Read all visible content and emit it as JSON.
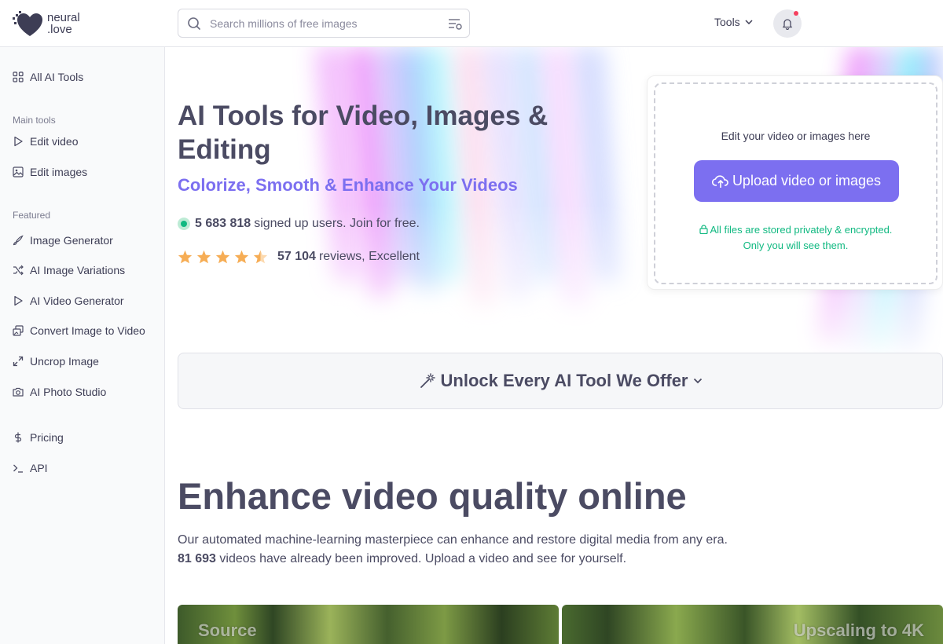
{
  "header": {
    "logo_line1": "neural",
    "logo_line2": ".love",
    "search_placeholder": "Search millions of free images",
    "tools_label": "Tools"
  },
  "sidebar": {
    "all_tools": "All AI Tools",
    "main_heading": "Main tools",
    "main_items": [
      "Edit video",
      "Edit images"
    ],
    "featured_heading": "Featured",
    "featured_items": [
      "Image Generator",
      "AI Image Variations",
      "AI Video Generator",
      "Convert Image to Video",
      "Uncrop Image",
      "AI Photo Studio"
    ],
    "bottom_items": [
      "Pricing",
      "API"
    ]
  },
  "hero": {
    "title": "AI Tools for Video, Images & Editing",
    "subtitle": "Colorize, Smooth & Enhance Your Videos",
    "users_count": "5 683 818",
    "users_text": "signed up users. Join for free.",
    "rating_stars": 4.5,
    "reviews_count": "57 104",
    "reviews_text": "reviews, Excellent"
  },
  "upload": {
    "hint": "Edit your video or images here",
    "button": "Upload video or images",
    "secure_line1": "All files are stored privately & encrypted.",
    "secure_line2": "Only you will see them."
  },
  "unlock": {
    "label": "Unlock Every AI Tool We Offer"
  },
  "section": {
    "title": "Enhance video quality online",
    "desc_line1": "Our automated machine-learning masterpiece can enhance and restore digital media from any era.",
    "videos_count": "81 693",
    "desc_line2": "videos have already been improved. Upload a video and see for yourself."
  },
  "compare": {
    "left_label": "Source",
    "right_label": "Upscaling to 4K"
  },
  "colors": {
    "accent": "#7c6ff0",
    "success": "#10b981",
    "star": "#f6ad55",
    "notify": "#f43f5e"
  }
}
